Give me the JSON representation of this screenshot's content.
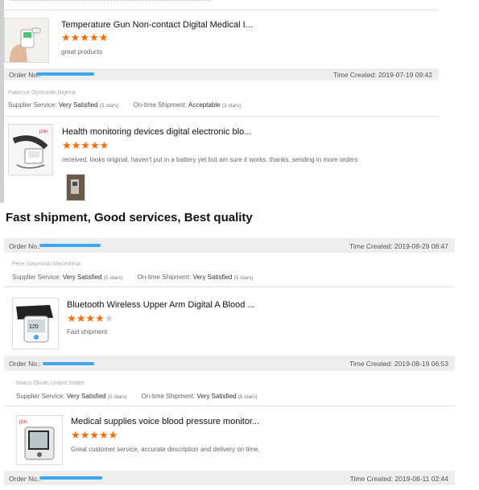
{
  "tagline": "Fast shipment, Good services, Best quality",
  "colors": {
    "star": "#ff6a00",
    "masked_order": "#3da8ef",
    "bar_bg": "#eeeeee"
  },
  "labels": {
    "order_no": "Order No.:",
    "supplier_service": "Supplier Service:",
    "ontime_shipment": "On-time Shipment:"
  },
  "section_a": {
    "items": [
      {
        "title": "Temperature Gun Non-contact Digital Medical I...",
        "stars": 5,
        "review": "great products",
        "time": "Time Created: 2019-07-19 09:42"
      },
      {
        "buyer": "Patience Oyetunde,Nigeria",
        "supplier_rating": "Very Satisfied",
        "supplier_stars": "(5 stars)",
        "shipment_rating": "Acceptable",
        "shipment_stars": "(3 stars)",
        "title": "Health monitoring devices digital electronic blo...",
        "stars": 5,
        "review": "received. looks original. haven't put in a battery yet but am sure it works. thanks. sending in more orders"
      }
    ]
  },
  "section_b": {
    "first_time": "Time Created: 2019-08-29 08:47",
    "reviews": [
      {
        "buyer": "Pece Naumoski,Macedonia",
        "supplier_rating": "Very Satisfied",
        "supplier_stars": "(5 stars)",
        "shipment_rating": "Very Satisfied",
        "shipment_stars": "(5 stars)",
        "title": "Bluetooth Wireless Upper Arm Digital A Blood ...",
        "stars": 4,
        "review": "Fast shipment",
        "time": "Time Created: 2019-08-19 06:53"
      },
      {
        "buyer": "Marco Olivas,United States",
        "supplier_rating": "Very Satisfied",
        "supplier_stars": "(5 stars)",
        "shipment_rating": "Very Satisfied",
        "shipment_stars": "(5 stars)",
        "title": "Medical supplies voice blood pressure monitor...",
        "stars": 5,
        "review": "Great customer service, accurate description and delivery on time.",
        "time": "Time Created: 2019-08-11 02:44"
      }
    ]
  }
}
